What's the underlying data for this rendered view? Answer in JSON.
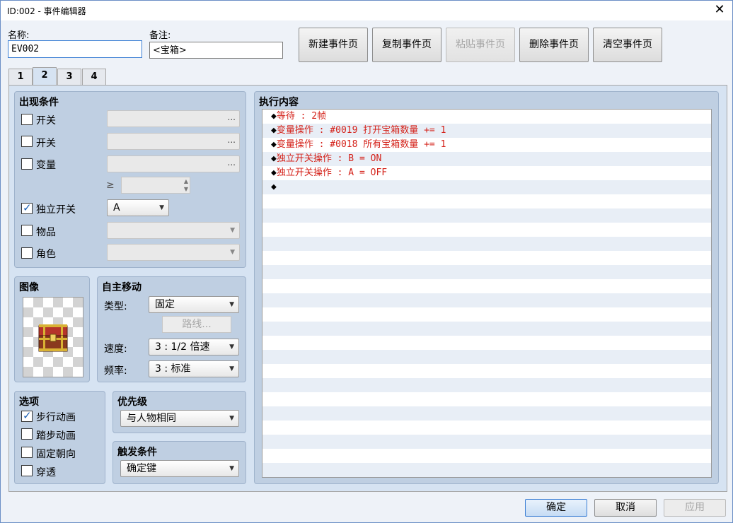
{
  "window": {
    "title": "ID:002 - 事件编辑器",
    "close_glyph": "✕"
  },
  "name_field": {
    "label": "名称:",
    "value": "EV002"
  },
  "note_field": {
    "label": "备注:",
    "value": "<宝箱>"
  },
  "toolbar": {
    "new_page": "新建事件页",
    "copy_page": "复制事件页",
    "paste_page": "粘贴事件页",
    "delete_page": "删除事件页",
    "clear_page": "清空事件页"
  },
  "tabs": [
    {
      "label": "1",
      "active": false
    },
    {
      "label": "2",
      "active": true
    },
    {
      "label": "3",
      "active": false
    },
    {
      "label": "4",
      "active": false
    }
  ],
  "conditions": {
    "title": "出现条件",
    "switch1": {
      "label": "开关",
      "checked": false,
      "value": "",
      "button": "..."
    },
    "switch2": {
      "label": "开关",
      "checked": false,
      "value": "",
      "button": "..."
    },
    "variable": {
      "label": "变量",
      "checked": false,
      "value": "",
      "button": "...",
      "operator": "≥",
      "amount": ""
    },
    "self_switch": {
      "label": "独立开关",
      "checked": true,
      "value": "A"
    },
    "item": {
      "label": "物品",
      "checked": false,
      "value": ""
    },
    "actor": {
      "label": "角色",
      "checked": false,
      "value": ""
    }
  },
  "image": {
    "title": "图像",
    "sprite": "treasure-chest"
  },
  "autonomous": {
    "title": "自主移动",
    "type_label": "类型:",
    "type_value": "固定",
    "route_button": "路线...",
    "speed_label": "速度:",
    "speed_value": "3 : 1/2 倍速",
    "freq_label": "频率:",
    "freq_value": "3 : 标准"
  },
  "options": {
    "title": "选项",
    "items": [
      {
        "label": "步行动画",
        "checked": true
      },
      {
        "label": "踏步动画",
        "checked": false
      },
      {
        "label": "固定朝向",
        "checked": false
      },
      {
        "label": "穿透",
        "checked": false
      }
    ]
  },
  "priority": {
    "title": "优先级",
    "value": "与人物相同"
  },
  "trigger": {
    "title": "触发条件",
    "value": "确定键"
  },
  "contents": {
    "title": "执行内容",
    "bullet": "◆",
    "commands": [
      "等待 : 2帧",
      "变量操作 : #0019 打开宝箱数量 += 1",
      "变量操作 : #0018 所有宝箱数量 += 1",
      "独立开关操作 : B = ON",
      "独立开关操作 : A = OFF",
      ""
    ]
  },
  "footer": {
    "ok": "确定",
    "cancel": "取消",
    "apply": "应用"
  },
  "colors": {
    "command_text": "#d4221a",
    "panel": "#bfcfe2",
    "accent": "#3c7fd4"
  }
}
